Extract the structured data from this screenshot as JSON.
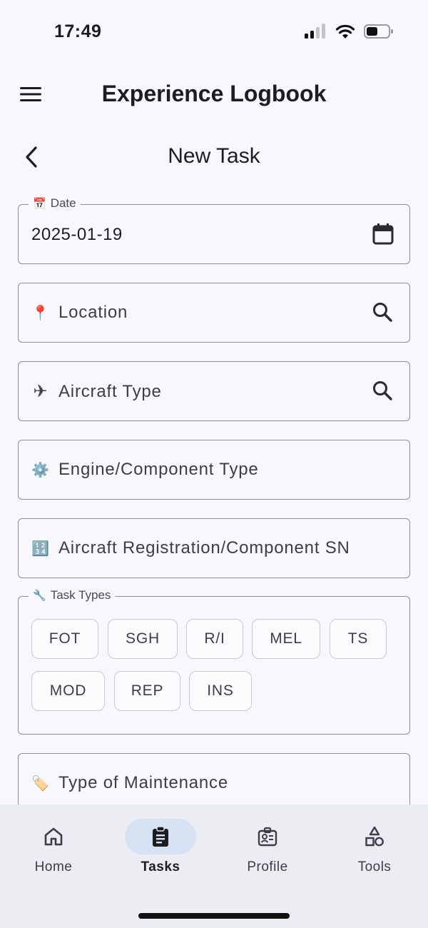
{
  "status": {
    "time": "17:49"
  },
  "app": {
    "title": "Experience Logbook"
  },
  "page": {
    "title": "New Task"
  },
  "fields": {
    "date": {
      "legend": "Date",
      "legend_emoji": "📅",
      "value": "2025-01-19"
    },
    "location": {
      "emoji": "📍",
      "placeholder": "Location"
    },
    "aircraft_type": {
      "emoji": "✈",
      "placeholder": "Aircraft Type"
    },
    "engine_type": {
      "emoji": "⚙️",
      "placeholder": "Engine/Component Type"
    },
    "registration": {
      "emoji": "🔢",
      "placeholder": "Aircraft Registration/Component SN"
    },
    "maintenance": {
      "emoji": "🏷️",
      "placeholder": "Type of Maintenance"
    }
  },
  "task_types": {
    "legend": "Task Types",
    "legend_emoji": "🔧",
    "chips": [
      "FOT",
      "SGH",
      "R/I",
      "MEL",
      "TS",
      "MOD",
      "REP",
      "INS"
    ]
  },
  "nav": {
    "items": [
      {
        "label": "Home",
        "icon": "home-icon"
      },
      {
        "label": "Tasks",
        "icon": "clipboard-icon",
        "active": true
      },
      {
        "label": "Profile",
        "icon": "id-badge-icon"
      },
      {
        "label": "Tools",
        "icon": "shapes-icon"
      }
    ]
  }
}
